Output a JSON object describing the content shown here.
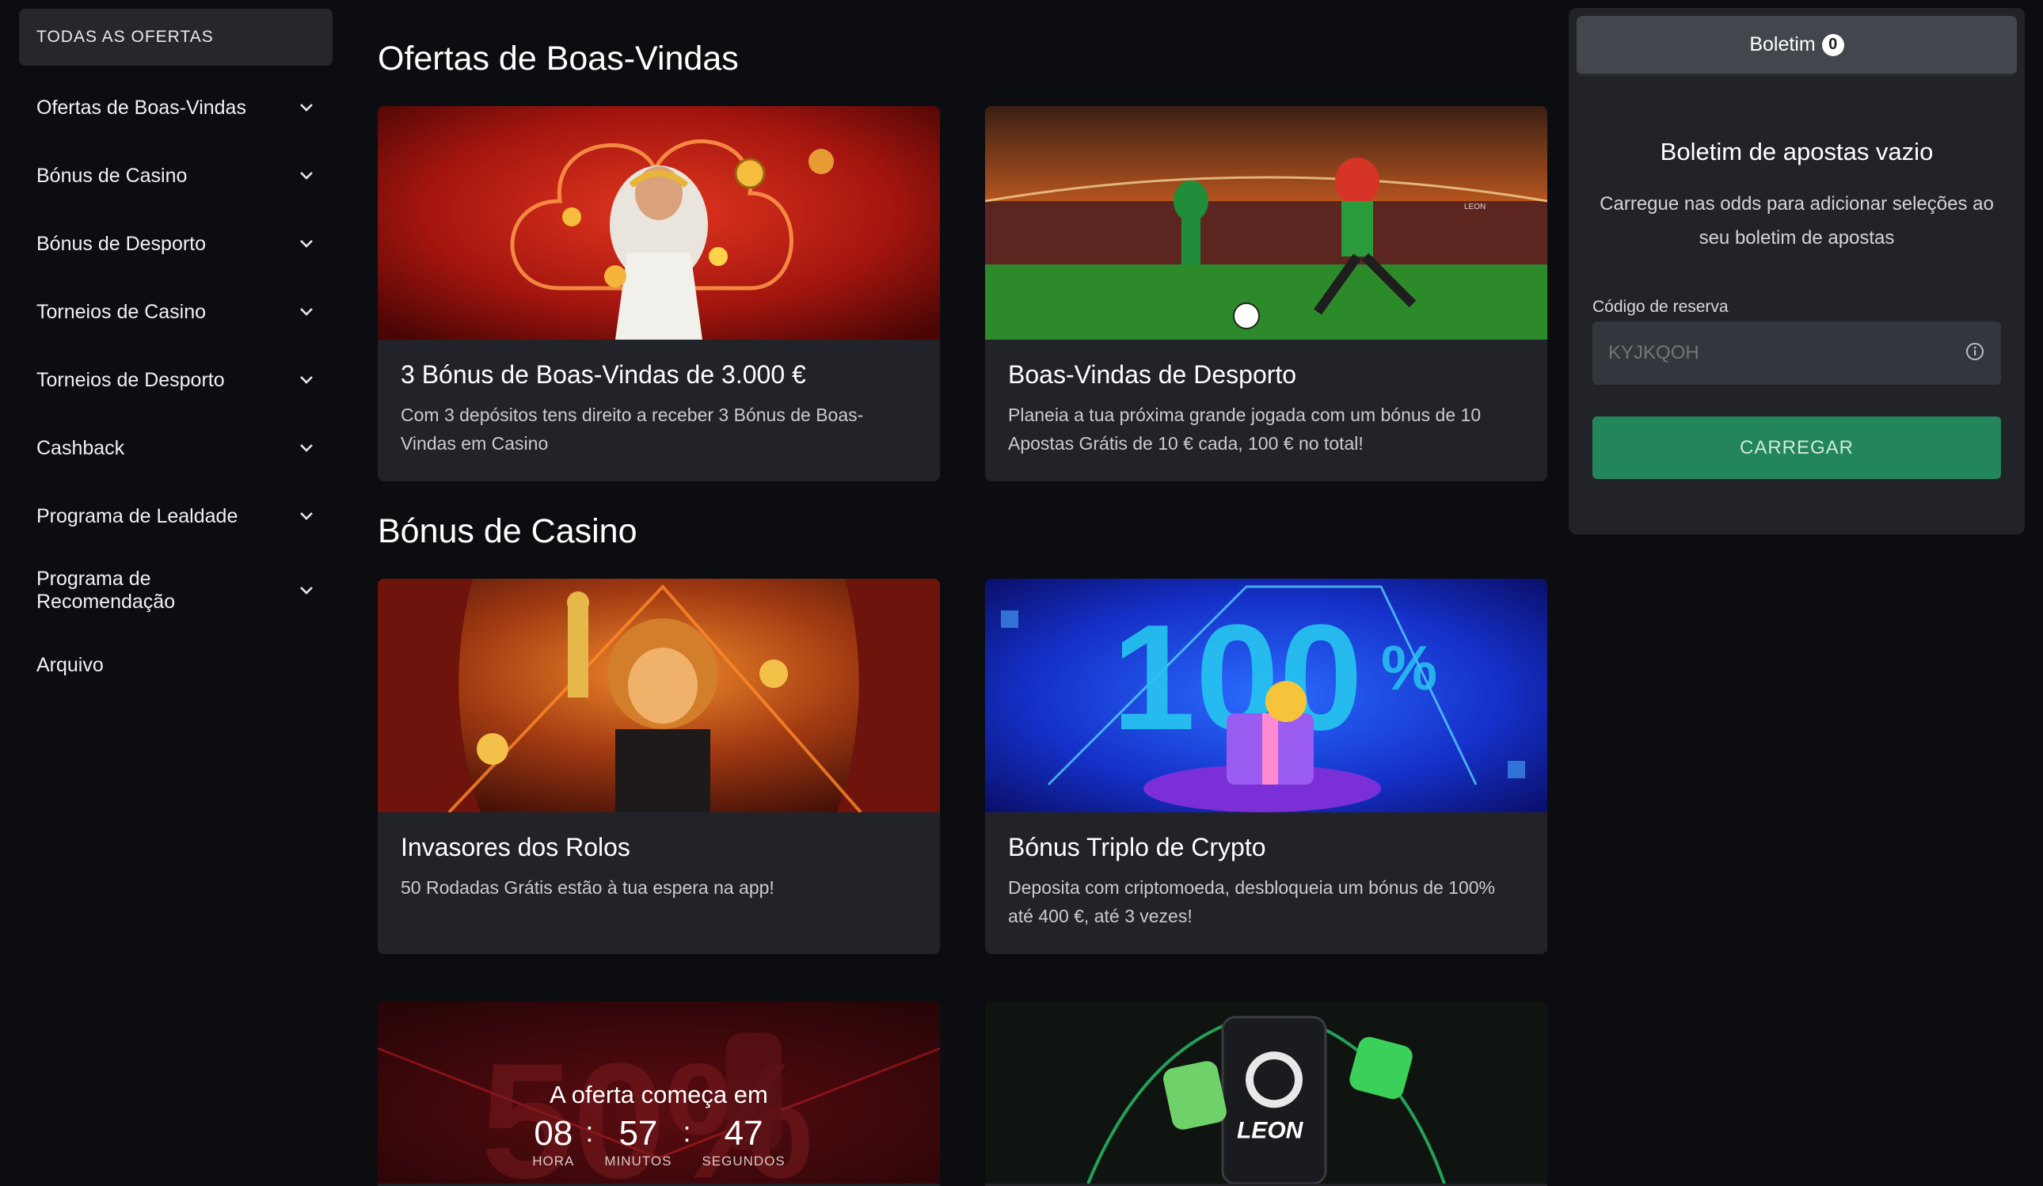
{
  "sidebar": {
    "all_offers": "TODAS AS OFERTAS",
    "items": [
      {
        "label": "Ofertas de Boas-Vindas"
      },
      {
        "label": "Bónus de Casino"
      },
      {
        "label": "Bónus de Desporto"
      },
      {
        "label": "Torneios de Casino"
      },
      {
        "label": "Torneios de Desporto"
      },
      {
        "label": "Cashback"
      },
      {
        "label": "Programa de Lealdade"
      },
      {
        "label": "Programa de\nRecomendação"
      },
      {
        "label": "Arquivo"
      }
    ]
  },
  "sections": [
    {
      "title": "Ofertas de Boas-Vindas",
      "cards": [
        {
          "title": "3 Bónus de Boas-Vindas de 3.000 €",
          "desc": "Com 3 depósitos tens direito a receber 3 Bónus de Boas-Vindas em Casino"
        },
        {
          "title": "Boas-Vindas de Desporto",
          "desc": "Planeia a tua próxima grande jogada com um bónus de 10 Apostas Grátis de 10 € cada, 100 € no total!"
        }
      ]
    },
    {
      "title": "Bónus de Casino",
      "cards": [
        {
          "title": "Invasores dos Rolos",
          "desc": "50 Rodadas Grátis estão à tua espera na app!"
        },
        {
          "title": "Bónus Triplo de Crypto",
          "desc": "Deposita com criptomoeda, desbloqueia um bónus de 100% até 400 €, até 3 vezes!"
        }
      ]
    }
  ],
  "countdown": {
    "title": "A oferta começa em",
    "hours": "08",
    "minutes": "57",
    "seconds": "47",
    "hours_label": "HORA",
    "minutes_label": "MINUTOS",
    "seconds_label": "SEGUNDOS",
    "banner_text": "50%"
  },
  "app_banner": {
    "brand": "LEON"
  },
  "betslip": {
    "tab_label": "Boletim",
    "count": "0",
    "empty_title": "Boletim de apostas vazio",
    "empty_desc": "Carregue nas odds para adicionar seleções ao seu boletim de apostas",
    "code_label": "Código de reserva",
    "code_placeholder": "KYJKQOH",
    "load_label": "CARREGAR"
  },
  "colors": {
    "background": "#0c0d10",
    "card": "#212328",
    "accent_green": "#23855a"
  }
}
